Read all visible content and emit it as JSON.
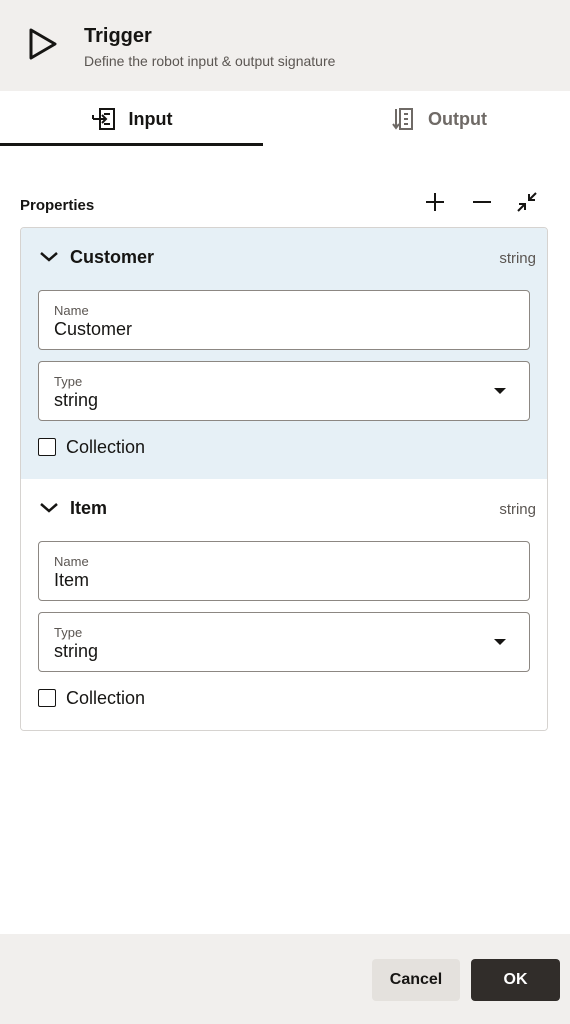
{
  "header": {
    "title": "Trigger",
    "subtitle": "Define the robot input & output signature",
    "icon": "play-icon"
  },
  "tabs": [
    {
      "label": "Input",
      "icon": "input-icon",
      "selected": true
    },
    {
      "label": "Output",
      "icon": "output-icon",
      "selected": false
    }
  ],
  "properties": {
    "label": "Properties",
    "tools": [
      "add-icon",
      "remove-icon",
      "collapse-all-icon"
    ],
    "items": [
      {
        "name": "Customer",
        "type_tag": "string",
        "name_label": "Name",
        "name_value": "Customer",
        "type_label": "Type",
        "type_value": "string",
        "collection_label": "Collection",
        "collection_checked": false,
        "highlighted": true
      },
      {
        "name": "Item",
        "type_tag": "string",
        "name_label": "Name",
        "name_value": "Item",
        "type_label": "Type",
        "type_value": "string",
        "collection_label": "Collection",
        "collection_checked": false,
        "highlighted": false
      }
    ]
  },
  "footer": {
    "cancel_label": "Cancel",
    "ok_label": "OK"
  },
  "colors": {
    "header_bg": "#f1efed",
    "highlight_bg": "#e6f0f6",
    "primary_button": "#312d2a"
  }
}
